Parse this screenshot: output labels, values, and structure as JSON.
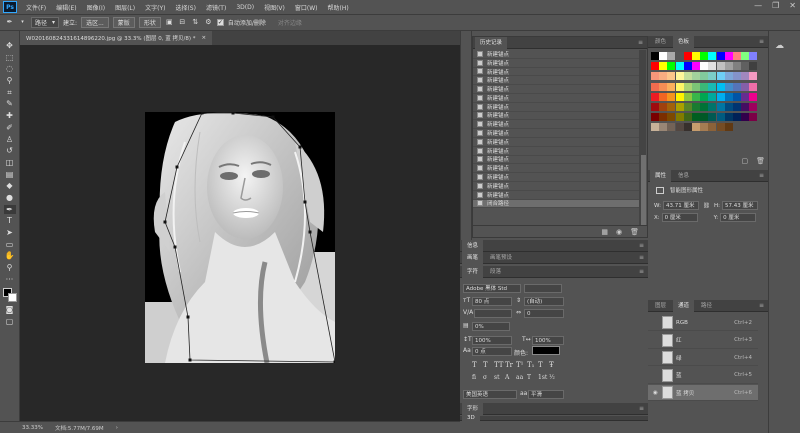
{
  "app": {
    "logo": "Ps"
  },
  "menu": [
    "文件(F)",
    "编辑(E)",
    "图像(I)",
    "图层(L)",
    "文字(Y)",
    "选择(S)",
    "滤镜(T)",
    "3D(D)",
    "视图(V)",
    "窗口(W)",
    "帮助(H)"
  ],
  "window_controls": {
    "minimize": "—",
    "restore": "❐",
    "close": "✕"
  },
  "options": {
    "mode_select": "路径",
    "make_select": "建立:",
    "selection_btn": "选区...",
    "mask_btn": "蒙版",
    "shape_btn": "形状",
    "auto_add_delete": "自动添加/删除",
    "align_edges": "对齐边缘"
  },
  "document": {
    "tab_title": "W020160824331614896220.jpg @ 33.3% (图层 0, 蓝 拷贝/8) *",
    "tab_close": "×"
  },
  "status": {
    "zoom": "33.33%",
    "docinfo": "文档:5.77M/7.69M"
  },
  "history": {
    "tab": "历史记录",
    "items": [
      "新建锚点",
      "新建锚点",
      "新建锚点",
      "新建锚点",
      "新建锚点",
      "新建锚点",
      "新建锚点",
      "新建锚点",
      "新建锚点",
      "新建锚点",
      "新建锚点",
      "新建锚点",
      "新建锚点",
      "新建锚点",
      "新建锚点",
      "新建锚点",
      "新建锚点",
      "闭合路径"
    ],
    "selected_index": 17
  },
  "color_tabs": [
    "颜色",
    "色板"
  ],
  "swatches": {
    "row1": [
      "#000000",
      "#ffffff",
      "#aaaaaa",
      "#555555",
      "#ff0000",
      "#ffff00",
      "#00ff00",
      "#00ffff",
      "#0000ff",
      "#ff00ff",
      "#ff8080",
      "#80ff80",
      "#8080ff"
    ],
    "rows": [
      [
        "#ff0000",
        "#ffff00",
        "#00ff00",
        "#00ffff",
        "#0000ff",
        "#ff00ff",
        "#ffffff",
        "#e0e0e0",
        "#c0c0c0",
        "#a0a0a0",
        "#808080",
        "#606060",
        "#404040"
      ],
      [
        "#f7977a",
        "#f9ad81",
        "#fdc68a",
        "#fff79a",
        "#c4df9b",
        "#a2d39c",
        "#82ca9d",
        "#7bcdc8",
        "#6ecff6",
        "#7ea7d8",
        "#8493ca",
        "#a187be",
        "#f49ac2"
      ],
      [
        "#f26c4f",
        "#f68e55",
        "#fbaf5c",
        "#fff467",
        "#acd373",
        "#7cc576",
        "#3bb878",
        "#1abbb4",
        "#00bff3",
        "#438ccb",
        "#5574b9",
        "#855fa8",
        "#f06ea9"
      ],
      [
        "#ed1c24",
        "#f26522",
        "#f7941d",
        "#fff200",
        "#8dc63f",
        "#39b54a",
        "#00a651",
        "#00a99d",
        "#00aeef",
        "#0072bc",
        "#0054a6",
        "#662d91",
        "#ec008c"
      ],
      [
        "#9e0b0f",
        "#a0410d",
        "#a36209",
        "#aba000",
        "#598527",
        "#1a7b30",
        "#007236",
        "#00746b",
        "#0076a3",
        "#004b80",
        "#003471",
        "#440e62",
        "#9e005d"
      ],
      [
        "#790000",
        "#7b2e00",
        "#7d4900",
        "#827b00",
        "#406618",
        "#005e20",
        "#005826",
        "#005952",
        "#005b7f",
        "#003663",
        "#002157",
        "#32004b",
        "#7b0046"
      ],
      [
        "#c7b299",
        "#998675",
        "#736357",
        "#534741",
        "#37302d",
        "#c69c6d",
        "#a67c52",
        "#8c6239",
        "#754c24",
        "#603913"
      ]
    ]
  },
  "properties": {
    "tabs": [
      "属性",
      "信息"
    ],
    "section": "智能图形属性",
    "w_label": "W:",
    "w_value": "43.71 厘米",
    "h_label": "H:",
    "h_value": "57.43 厘米",
    "x_label": "X:",
    "x_value": "0 厘米",
    "y_label": "Y:",
    "y_value": "0 厘米"
  },
  "mid_tabs": {
    "info": "信息",
    "brush_tabs": [
      "画笔",
      "画笔预设"
    ],
    "char_tabs": [
      "字符",
      "段落"
    ],
    "bottom_tab1": "字形",
    "bottom_tab2": "3D"
  },
  "character": {
    "font": "Adobe 黑体 Std",
    "style": "",
    "size": "80 点",
    "leading": "(自动)",
    "kerning": "",
    "tracking": "0",
    "scale_label": "0%",
    "vscale": "100%",
    "hscale": "100%",
    "baseline": "0 点",
    "color_label": "颜色:",
    "style_buttons": [
      "T",
      "T",
      "TT",
      "Tr",
      "T¹",
      "T₁",
      "T",
      "Ŧ"
    ],
    "ot_buttons": [
      "fi",
      "σ",
      "st",
      "A",
      "aa",
      "T",
      "1st",
      "½"
    ],
    "language": "美国英语",
    "aa_label": "aa",
    "aa_mode": "平滑"
  },
  "layers": {
    "tabs": [
      "图层",
      "通道",
      "路径"
    ],
    "rows": [
      {
        "name": "RGB",
        "shortcut": "Ctrl+2"
      },
      {
        "name": "红",
        "shortcut": "Ctrl+3"
      },
      {
        "name": "绿",
        "shortcut": "Ctrl+4"
      },
      {
        "name": "蓝",
        "shortcut": "Ctrl+5"
      },
      {
        "name": "蓝 拷贝",
        "shortcut": "Ctrl+6"
      }
    ],
    "selected_index": 4
  },
  "colors": {
    "accent": "#31a8ff",
    "canvas_bg": "#282828",
    "ui_bg": "#535353"
  }
}
